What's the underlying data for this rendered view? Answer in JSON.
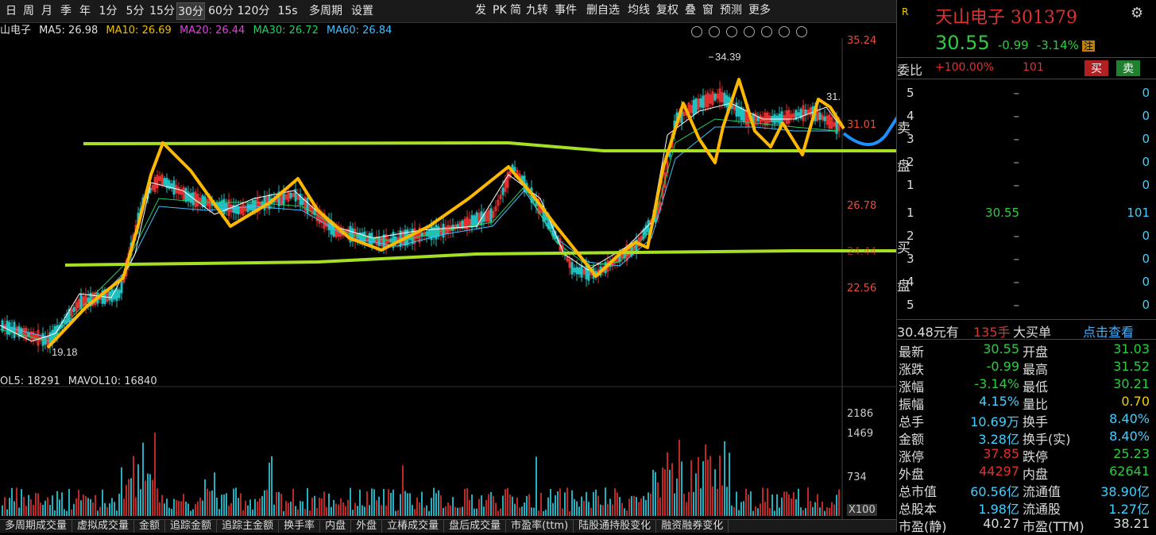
{
  "toolbar": {
    "periods": [
      "日",
      "周",
      "月",
      "季",
      "年",
      "1分",
      "5分",
      "15分",
      "30分",
      "60分",
      "120分",
      "15s",
      "多周期",
      "设置"
    ],
    "active_period": "30分",
    "right_tools": [
      "发",
      "PK",
      "简",
      "九转",
      "事件",
      "删自选",
      "均线",
      "复权",
      "叠",
      "窗",
      "预测",
      "更多"
    ]
  },
  "ma_line": {
    "name": "山电子",
    "ma5": "MA5: 26.98",
    "ma10": "MA10: 26.69",
    "ma20": "MA20: 26.44",
    "ma30": "MA30: 26.72",
    "ma60": "MA60: 26.84",
    "colors": {
      "ma5": "#e0e0e0",
      "ma10": "#f0c000",
      "ma20": "#e040e0",
      "ma30": "#20d060",
      "ma60": "#40c0ff"
    }
  },
  "price_axis": [
    "35.24",
    "31.01",
    "26.78",
    "24.44",
    "22.56"
  ],
  "chart_annotations": {
    "high": "34.39",
    "low": "19.18",
    "last_visible": "31."
  },
  "volume": {
    "vol5": "OL5: 18291",
    "mavol10": "MAVOL10: 16840",
    "axis": [
      "2186",
      "1469",
      "734"
    ],
    "multiplier": "X100"
  },
  "stock": {
    "name": "天山电子",
    "code": "301379",
    "price": "30.55",
    "change": "-0.99",
    "change_pct": "-3.14%",
    "badge": "注"
  },
  "order_ratio": {
    "label": "委比",
    "ratio": "+100.00%",
    "diff": "101",
    "buy": "买",
    "sell": "卖"
  },
  "sell_side": {
    "label": "卖盘",
    "levels": [
      {
        "n": "5",
        "price": "–",
        "vol": "0"
      },
      {
        "n": "4",
        "price": "–",
        "vol": "0"
      },
      {
        "n": "3",
        "price": "–",
        "vol": "0"
      },
      {
        "n": "2",
        "price": "–",
        "vol": "0"
      },
      {
        "n": "1",
        "price": "–",
        "vol": "0"
      }
    ]
  },
  "buy_side": {
    "label": "买盘",
    "levels": [
      {
        "n": "1",
        "price": "30.55",
        "vol": "101"
      },
      {
        "n": "2",
        "price": "–",
        "vol": "0"
      },
      {
        "n": "3",
        "price": "–",
        "vol": "0"
      },
      {
        "n": "4",
        "price": "–",
        "vol": "0"
      },
      {
        "n": "5",
        "price": "–",
        "vol": "0"
      }
    ]
  },
  "big_order": {
    "price": "30.48元有",
    "hands": "135手",
    "text": "大买单",
    "link": "点击查看"
  },
  "quote": [
    {
      "l1": "最新",
      "v1": "30.55",
      "c1": "grn",
      "l2": "开盘",
      "v2": "31.03",
      "c2": "grn"
    },
    {
      "l1": "涨跌",
      "v1": "-0.99",
      "c1": "grn",
      "l2": "最高",
      "v2": "31.52",
      "c2": "grn"
    },
    {
      "l1": "涨幅",
      "v1": "-3.14%",
      "c1": "grn",
      "l2": "最低",
      "v2": "30.21",
      "c2": "grn"
    },
    {
      "l1": "振幅",
      "v1": "4.15%",
      "c1": "cyan",
      "l2": "量比",
      "v2": "0.70",
      "c2": "yel"
    },
    {
      "l1": "总手",
      "v1": "10.69万",
      "c1": "cyan",
      "l2": "换手",
      "v2": "8.40%",
      "c2": "cyan"
    },
    {
      "l1": "金额",
      "v1": "3.28亿",
      "c1": "cyan",
      "l2": "换手(实)",
      "v2": "8.40%",
      "c2": "cyan"
    },
    {
      "l1": "涨停",
      "v1": "37.85",
      "c1": "red",
      "l2": "跌停",
      "v2": "25.23",
      "c2": "grn"
    },
    {
      "l1": "外盘",
      "v1": "44297",
      "c1": "red",
      "l2": "内盘",
      "v2": "62641",
      "c2": "grn"
    },
    {
      "l1": "总市值",
      "v1": "60.56亿",
      "c1": "cyan",
      "l2": "流通值",
      "v2": "38.90亿",
      "c2": "cyan"
    },
    {
      "l1": "总股本",
      "v1": "1.98亿",
      "c1": "cyan",
      "l2": "流通股",
      "v2": "1.27亿",
      "c2": "cyan"
    },
    {
      "l1": "市盈(静)",
      "v1": "40.27",
      "c1": "wht",
      "l2": "市盈(TTM)",
      "v2": "38.21",
      "c2": "wht"
    }
  ],
  "bottom_tabs": [
    "多周期成交量",
    "虚拟成交量",
    "金额",
    "追踪金额",
    "追踪主金额",
    "换手率",
    "内盘",
    "外盘",
    "立椿成交量",
    "盘后成交量",
    "市盈率(ttm)",
    "陆股通持股变化",
    "融资融券变化"
  ]
}
